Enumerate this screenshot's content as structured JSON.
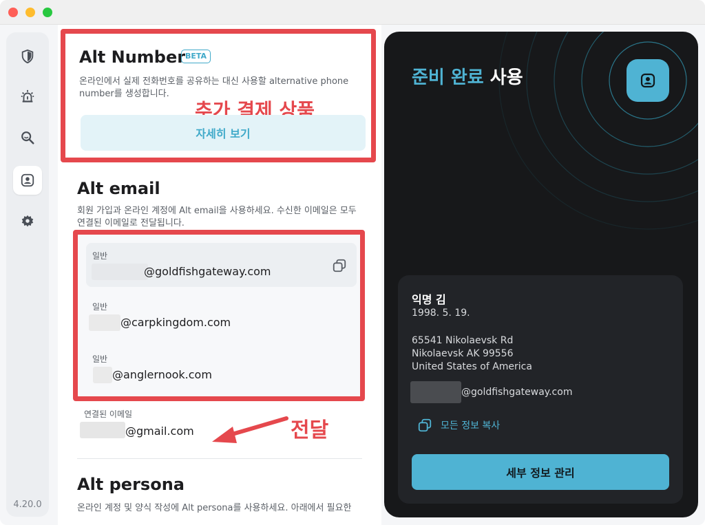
{
  "window": {
    "title": ""
  },
  "sidebar": {
    "items": [
      {
        "icon": "shield-icon"
      },
      {
        "icon": "alert-icon"
      },
      {
        "icon": "search-icon"
      },
      {
        "icon": "person-icon",
        "active": true
      },
      {
        "icon": "gear-icon"
      }
    ],
    "version": "4.20.0"
  },
  "alt_number": {
    "title": "Alt Number",
    "badge": "BETA",
    "description": "온라인에서 실제 전화번호를 공유하는 대신 사용할 alternative phone number를 생성합니다.",
    "annotation": "추가 결제 상품",
    "button": "자세히 보기"
  },
  "alt_email": {
    "title": "Alt email",
    "description": "회원 가입과 온라인 계정에 Alt email을 사용하세요. 수신한 이메일은 모두 연결된 이메일로 전달됩니다.",
    "emails": [
      {
        "tag": "일반",
        "address": "@goldfishgateway.com"
      },
      {
        "tag": "일반",
        "address": "@carpkingdom.com"
      },
      {
        "tag": "일반",
        "address": "@anglernook.com"
      }
    ],
    "linked_label": "연결된 이메일",
    "linked_address": "@gmail.com",
    "annotation": "전달"
  },
  "alt_persona": {
    "title": "Alt persona",
    "description": "온라인 계정 및 양식 작성에 Alt persona를 사용하세요. 아래에서 필요한"
  },
  "panel": {
    "title_accent": "준비 완료",
    "title_rest": " 사용",
    "name": "익명   김",
    "dob": "1998. 5. 19.",
    "address_line1": "65541 Nikolaevsk Rd",
    "address_line2": "Nikolaevsk AK 99556",
    "address_line3": "United States of America",
    "email": "@goldfishgateway.com",
    "copy_all": "모든 정보 복사",
    "manage_button": "세부 정보 관리",
    "accent_color": "#4fb3d3"
  },
  "colors": {
    "highlight": "#e5484d",
    "accent": "#4fb3d3",
    "panel_bg": "#17181a"
  }
}
